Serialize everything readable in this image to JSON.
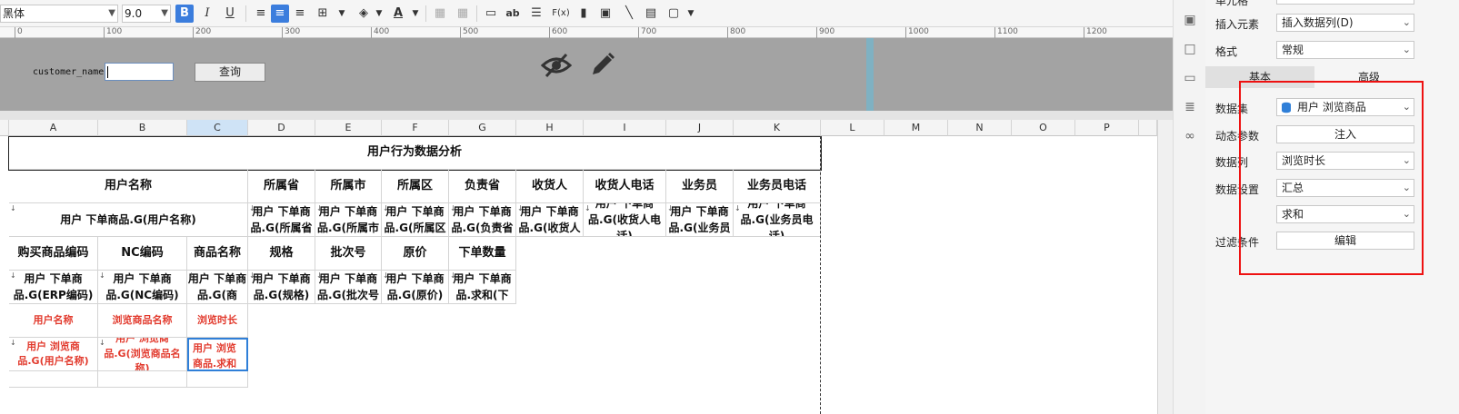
{
  "toolbar": {
    "font_name": "黑体",
    "font_size": "9.0",
    "bold": "B",
    "italic": "I",
    "underline": "U",
    "font_color_glyph": "A",
    "text_glyph": "ab",
    "formula_glyph": "F(x)"
  },
  "ruler": [
    "0",
    "100",
    "200",
    "300",
    "400",
    "500",
    "600",
    "700",
    "800",
    "900",
    "1000",
    "1100",
    "1200"
  ],
  "params": {
    "label": "customer_name",
    "input_value": "",
    "query_button": "查询"
  },
  "sheet": {
    "columns": [
      "A",
      "B",
      "C",
      "D",
      "E",
      "F",
      "G",
      "H",
      "I",
      "J",
      "K",
      "L",
      "M",
      "N",
      "O",
      "P"
    ],
    "selected_column": "C",
    "title": "用户行为数据分析",
    "row2": {
      "user_name": "用户名称",
      "province": "所属省",
      "city": "所属市",
      "district": "所属区",
      "manager": "负责省",
      "receiver": "收货人",
      "receiver_phone": "收货人电话",
      "salesman": "业务员",
      "salesman_phone": "业务员电话"
    },
    "row3": {
      "user_name": "用户 下单商品.G(用户名称)",
      "province": "用户 下单商品.G(所属省",
      "city": "用户 下单商品.G(所属市",
      "district": "用户 下单商品.G(所属区",
      "manager": "用户 下单商品.G(负责省",
      "receiver": "用户 下单商品.G(收货人",
      "receiver_phone": "用户 下单商品.G(收货人电话)",
      "salesman": "用户 下单商品.G(业务员",
      "salesman_phone": "用户 下单商品.G(业务员电话)"
    },
    "row4": [
      "购买商品编码",
      "NC编码",
      "商品名称",
      "规格",
      "批次号",
      "原价",
      "下单数量"
    ],
    "row5": [
      "用户 下单商品.G(ERP编码)",
      "用户 下单商品.G(NC编码)",
      "用户 下单商品.G(商",
      "用户 下单商品.G(规格)",
      "用户 下单商品.G(批次号",
      "用户 下单商品.G(原价)",
      "用户 下单商品.求和(下"
    ],
    "row6": [
      "用户名称",
      "浏览商品名称",
      "浏览时长"
    ],
    "row7": [
      "用户 浏览商品.G(用户名称)",
      "用户 浏览商品.G(浏览商品名称)",
      "用户 浏览商品.求和(浏览时长)"
    ]
  },
  "panel": {
    "top_label": "单元格",
    "insert_label": "插入元素",
    "insert_value": "插入数据列(D)",
    "format_label": "格式",
    "format_value": "常规",
    "tab_basic": "基本",
    "tab_advanced": "高级",
    "dataset_label": "数据集",
    "dataset_value": "用户 浏览商品",
    "dyn_param_label": "动态参数",
    "inject_button": "注入",
    "datacol_label": "数据列",
    "datacol_value": "浏览时长",
    "dataset_setting_label": "数据设置",
    "summary_value": "汇总",
    "sum_value": "求和",
    "filter_label": "过滤条件",
    "edit_button": "编辑"
  },
  "colors": {
    "accent": "#3b7ddd",
    "highlight_red": "#e11111",
    "red_text": "#e23b2e",
    "param_bg": "#a3a3a3"
  }
}
